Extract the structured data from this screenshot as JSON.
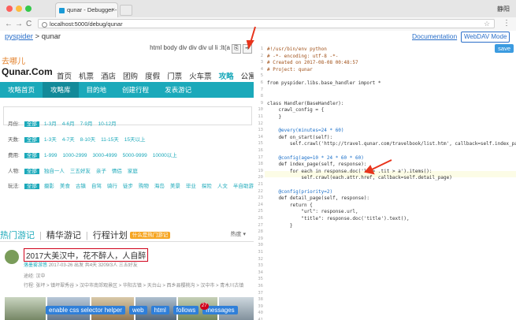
{
  "browser": {
    "tab_title": "qunar - Debugger - pyspider",
    "tab_close": "×",
    "user": "静阳",
    "url": "localhost:5000/debug/qunar",
    "back": "←",
    "forward": "→",
    "reload": "C",
    "star": "☆",
    "menu": "⋮"
  },
  "colors": {
    "teal": "#1ba9ba",
    "link": "#2a6fc9",
    "annotation_arrow": "#e8341c"
  },
  "header": {
    "crumb_root": "pyspider",
    "crumb_sep": " > ",
    "crumb_project": "qunar",
    "docs_link": "Documentation",
    "webdav": "WebDAV Mode"
  },
  "left": {
    "css_path": "html body div div div ul li :lt(a",
    "logo_cn": "去哪儿",
    "logo_en": "Qunar.Com",
    "nav": [
      "首页",
      "机票",
      "酒店",
      "团购",
      "度假",
      "门票",
      "火车票",
      "攻略",
      "公寓"
    ],
    "nav_active_index": 7,
    "teal_items": [
      "攻略首页",
      "攻略库",
      "目的地",
      "创建行程",
      "发表游记"
    ],
    "teal_selected_index": 1,
    "filters": [
      {
        "label": "月份:",
        "all": "全部",
        "opts": [
          "1-3月",
          "4-6月",
          "7-9月",
          "10-12月"
        ]
      },
      {
        "label": "天数:",
        "all": "全部",
        "opts": [
          "1-3天",
          "4-7天",
          "8-10天",
          "11-15天",
          "15天以上"
        ]
      },
      {
        "label": "费用:",
        "all": "全部",
        "opts": [
          "1-999",
          "1000-2999",
          "3000-4999",
          "5000-9999",
          "10000以上"
        ]
      },
      {
        "label": "人物:",
        "all": "全部",
        "opts": [
          "独自一人",
          "三五好友",
          "亲子",
          "情侣",
          "家庭"
        ]
      },
      {
        "label": "玩法:",
        "all": "全部",
        "opts": [
          "摄影",
          "美食",
          "古镇",
          "自驾",
          "骑行",
          "徒步",
          "购物",
          "海岛",
          "美景",
          "毕业",
          "探险",
          "人文",
          "半自助游"
        ]
      }
    ],
    "subtabs": [
      "热门游记",
      "精华游记",
      "行程计划"
    ],
    "subtab_badge": "什么是热门游记",
    "sort": "热度 ▾",
    "post_title": "2017大美汉中，花不醉人，人自醉",
    "post_author": "落墨雾游悠",
    "post_meta": "2017-03-26 出发  共4天  3209/3人  三五好友",
    "post_route_label": "途经:",
    "post_route": "汉中",
    "post_itinerary_label": "行程:",
    "post_itinerary": "张坪 > 镇坪翠秀谷 > 汉中市南郊观景区 > 华阳古镇 > 天台山 > 西乡县樱桃沟 > 汉中市 > 青木川古镇",
    "helper_buttons": [
      "enable css selector helper",
      "web",
      "html",
      "follows",
      "messages"
    ],
    "follows_count": "27"
  },
  "right": {
    "save_label": "save",
    "lines": [
      "#!/usr/bin/env python",
      "# -*- encoding: utf-8 -*-",
      "# Created on 2017-08-08 00:48:57",
      "# Project: qunar",
      "",
      "from pyspider.libs.base_handler import *",
      "",
      "",
      "class Handler(BaseHandler):",
      "    crawl_config = {",
      "    }",
      "",
      "    @every(minutes=24 * 60)",
      "    def on_start(self):",
      "        self.crawl('http://travel.qunar.com/travelbook/list.htm', callback=self.index_page)",
      "",
      "    @config(age=10 * 24 * 60 * 60)",
      "    def index_page(self, response):",
      "        for each in response.doc('li > .tit > a').items():",
      "            self.crawl(each.attr.href, callback=self.detail_page)",
      "",
      "    @config(priority=2)",
      "    def detail_page(self, response):",
      "        return {",
      "            \"url\": response.url,",
      "            \"title\": response.doc('title').text(),",
      "        }",
      "",
      "",
      "",
      "",
      "",
      "",
      "",
      "",
      "",
      "",
      "",
      "",
      "",
      "",
      ""
    ]
  }
}
